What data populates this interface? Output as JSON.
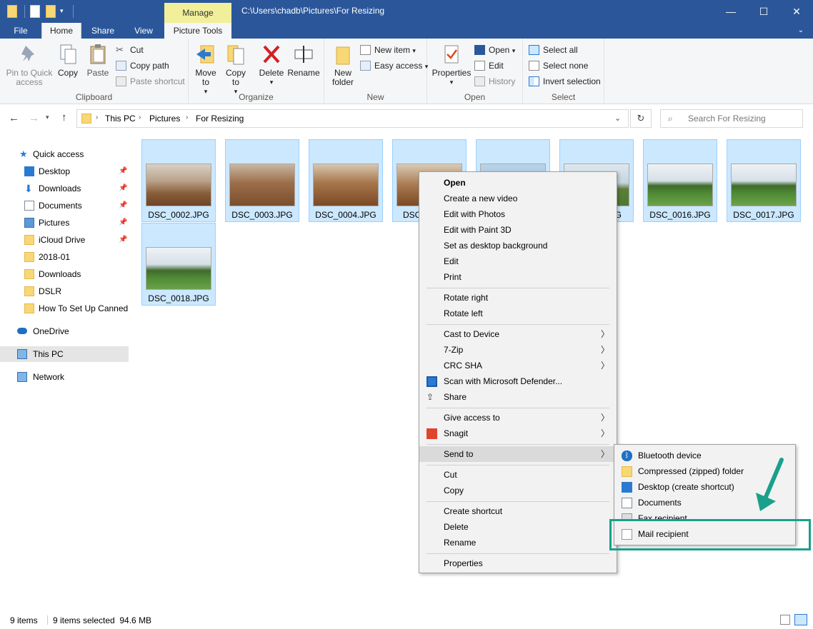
{
  "window": {
    "manage_tab": "Manage",
    "title_path": "C:\\Users\\chadb\\Pictures\\For Resizing",
    "minimize": "—",
    "maximize": "☐",
    "close": "✕"
  },
  "tabs": {
    "file": "File",
    "home": "Home",
    "share": "Share",
    "view": "View",
    "picture_tools": "Picture Tools"
  },
  "ribbon": {
    "clipboard": {
      "label": "Clipboard",
      "pin": "Pin to Quick access",
      "copy": "Copy",
      "paste": "Paste",
      "cut": "Cut",
      "copy_path": "Copy path",
      "paste_shortcut": "Paste shortcut"
    },
    "organize": {
      "label": "Organize",
      "move_to": "Move to",
      "copy_to": "Copy to",
      "delete": "Delete",
      "rename": "Rename"
    },
    "new": {
      "label": "New",
      "new_folder": "New folder",
      "new_item": "New item",
      "easy_access": "Easy access"
    },
    "open": {
      "label": "Open",
      "properties": "Properties",
      "open": "Open",
      "edit": "Edit",
      "history": "History"
    },
    "select": {
      "label": "Select",
      "select_all": "Select all",
      "select_none": "Select none",
      "invert": "Invert selection"
    }
  },
  "address": {
    "crumbs": [
      "This PC",
      "Pictures",
      "For Resizing"
    ],
    "search_placeholder": "Search For Resizing"
  },
  "nav": {
    "items": [
      "Quick access",
      "Desktop",
      "Downloads",
      "Documents",
      "Pictures",
      "iCloud Drive",
      "2018-01",
      "Downloads",
      "DSLR",
      "How To Set Up Canned I",
      "OneDrive",
      "This PC",
      "Network"
    ]
  },
  "files": [
    "DSC_0002.JPG",
    "DSC_0003.JPG",
    "DSC_0004.JPG",
    "DSC",
    "",
    "",
    "DSC_0016.JPG",
    "DSC_0017.JPG",
    "DSC_0018.JPG"
  ],
  "partial_label": "G",
  "context_menu": {
    "items": [
      "Open",
      "Create a new video",
      "Edit with Photos",
      "Edit with Paint 3D",
      "Set as desktop background",
      "Edit",
      "Print",
      "Rotate right",
      "Rotate left",
      "Cast to Device",
      "7-Zip",
      "CRC SHA",
      "Scan with Microsoft Defender...",
      "Share",
      "Give access to",
      "Snagit",
      "Send to",
      "Cut",
      "Copy",
      "Create shortcut",
      "Delete",
      "Rename",
      "Properties"
    ]
  },
  "send_to": {
    "items": [
      "Bluetooth device",
      "Compressed (zipped) folder",
      "Desktop (create shortcut)",
      "Documents",
      "Fax recipient",
      "Mail recipient"
    ]
  },
  "status": {
    "count": "9 items",
    "selected": "9 items selected  94.6 MB"
  },
  "colors": {
    "title_bar": "#2b579a",
    "manage_tab": "#f1ef9a",
    "selection": "#cce8ff",
    "highlight_box": "#1aa08a"
  }
}
